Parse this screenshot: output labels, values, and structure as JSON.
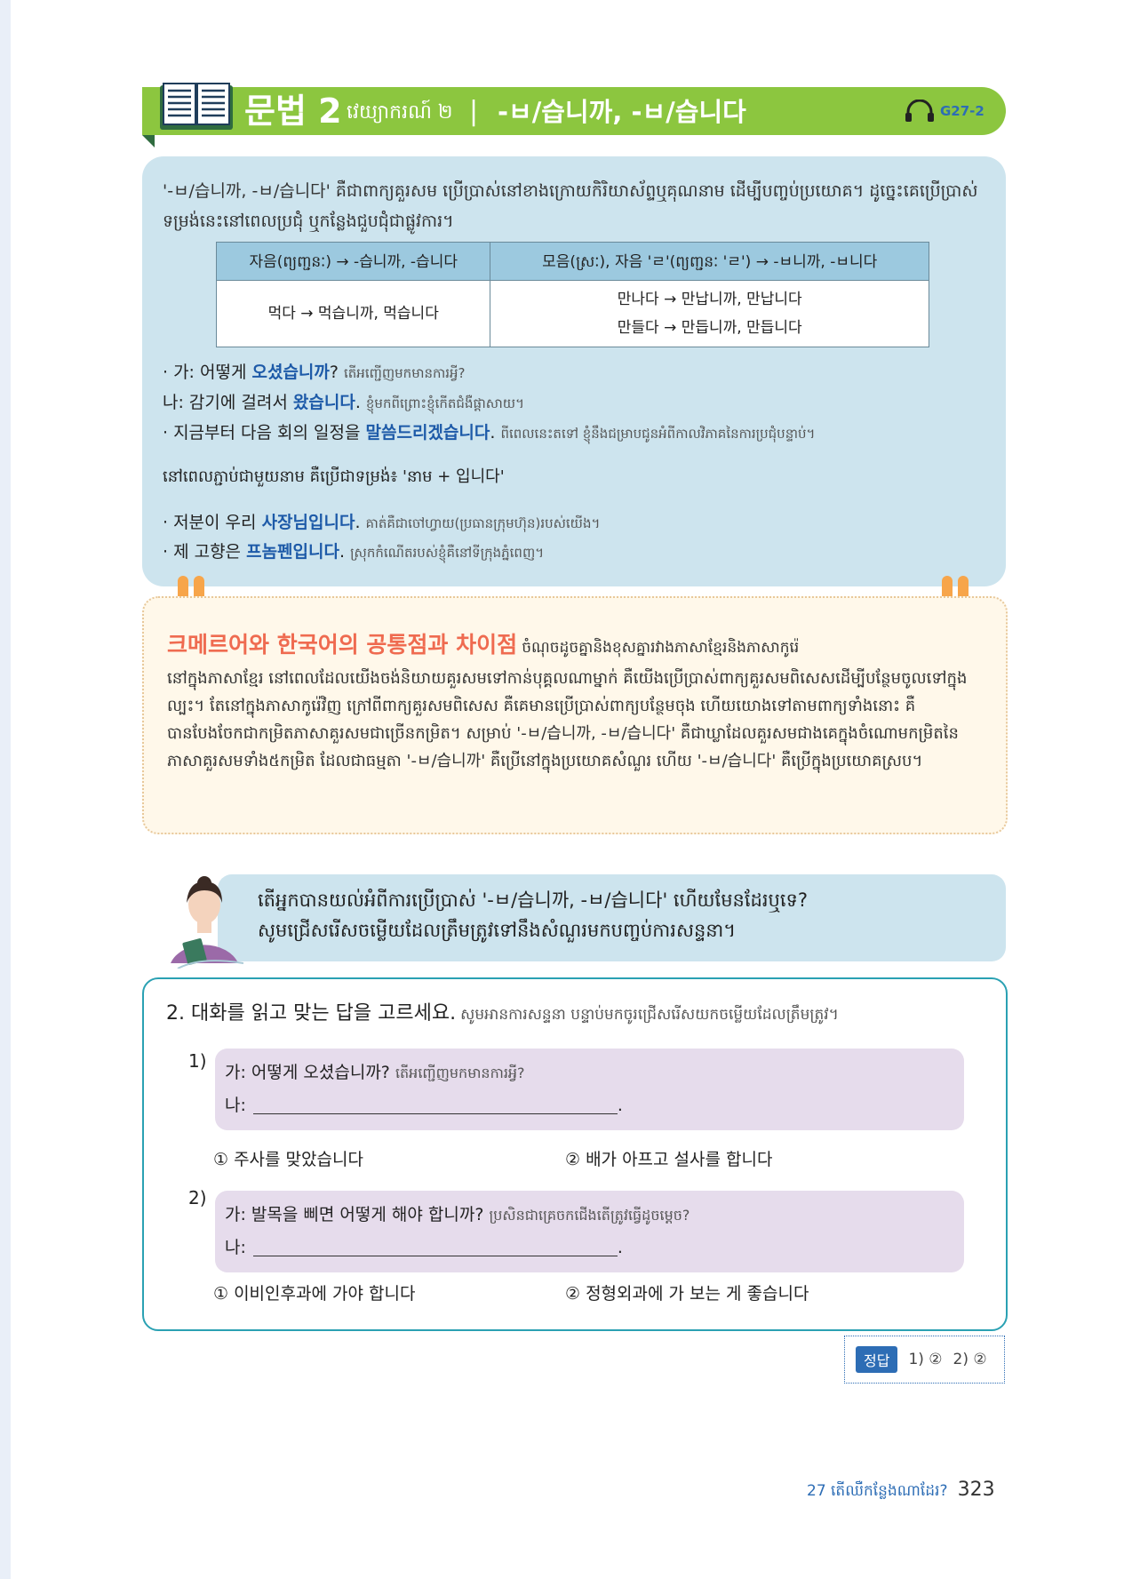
{
  "header": {
    "title": "문법 2",
    "khmer_subtitle": "វេយ្យាករណ៍ ២",
    "separator": "|",
    "form": "-ㅂ/습니까, -ㅂ/습니다",
    "audio_code": "G27-2"
  },
  "grammar": {
    "intro": "'-ㅂ/습니까, -ㅂ/습니다' គឺជាពាក្យគួរសម ប្រើប្រាស់នៅខាងក្រោយកិរិយាស័ព្ទឬគុណនាម ដើម្បីបញ្ចប់ប្រយោគ។ ដូច្នេះគេប្រើប្រាស់ទម្រង់នេះនៅពេលប្រជុំ ឬកន្លែងជួបជុំជាផ្លូវការ។",
    "table": {
      "headers": [
        "자음(ព្យញ្ជនៈ) → -습니까, -습니다",
        "모음(ស្រៈ), 자음 'ㄹ'(ព្យញ្ជនៈ 'ㄹ') → -ㅂ니까, -ㅂ니다"
      ],
      "cell1": "먹다 → 먹습니까, 먹습니다",
      "cell2_line1": "만나다 → 만납니까, 만납니다",
      "cell2_line2": "만들다 → 만듭니까, 만듭니다"
    },
    "examples": [
      {
        "pre": "· 가: 어떻게 ",
        "key": "오셨습니까",
        "post": "? ",
        "khmer": "តើអញ្ជើញមកមានការអ្វី?"
      },
      {
        "pre": "  나: 감기에 걸려서 ",
        "key": "왔습니다",
        "post": ". ",
        "khmer": "ខ្ញុំមកពីព្រោះខ្ញុំកើតជំងឺផ្ដាសាយ។"
      },
      {
        "pre": "· 지금부터 다음 회의 일정을 ",
        "key": "말씀드리겠습니다",
        "post": ". ",
        "khmer": "ពីពេលនេះតទៅ ខ្ញុំនឹងជម្រាបជូនអំពីកាលវិភាគនៃការប្រជុំបន្ទាប់។"
      }
    ],
    "noun_note": "នៅពេលភ្ជាប់ជាមួយនាម គឺប្រើជាទម្រង់៖ 'នាម + 입니다'",
    "noun_examples": [
      {
        "pre": "· 저분이 우리 ",
        "key": "사장님입니다",
        "post": ". ",
        "khmer": "គាត់គឺជាចៅហ្វាយ(ប្រធានក្រុមហ៊ុន)របស់យើង។"
      },
      {
        "pre": "· 제 고향은 ",
        "key": "프놈펜입니다",
        "post": ". ",
        "khmer": "ស្រុកកំណើតរបស់ខ្ញុំគឺនៅទីក្រុងភ្នំពេញ។"
      }
    ]
  },
  "compare": {
    "title_ko": "크메르어와 한국어의 공통점과 차이점",
    "title_km": "ចំណុចដូចគ្នានិងខុសគ្នារវាងភាសាខ្មែរនិងភាសាកូរ៉េ",
    "body": "នៅក្នុងភាសាខ្មែរ នៅពេលដែលយើងចង់និយាយគួរសមទៅកាន់បុគ្គលណាម្នាក់ គឺយើងប្រើប្រាស់ពាក្យគួរសមពិសេសដើម្បីបន្ថែមចូលទៅក្នុងល្បះ។ តែនៅក្នុងភាសាកូរ៉េវិញ ក្រៅពីពាក្យគួរសមពិសេស គឺគេមានប្រើប្រាស់ពាក្យបន្ថែមចុង ហើយយោងទៅតាមពាក្យទាំងនោះ គឺបានបែងចែកជាកម្រិតភាសាគួរសមជាច្រើនកម្រិត។ សម្រាប់ '-ㅂ/습니까, -ㅂ/습니다' គឺជាឃ្លាដែលគួរសមជាងគេក្នុងចំណោមកម្រិតនៃភាសាគួរសមទាំង៥កម្រិត ដែលជាធម្មតា '-ㅂ/습니까' គឺប្រើនៅក្នុងប្រយោគសំណួរ ហើយ '-ㅂ/습니다' គឺប្រើក្នុងប្រយោគស្រប។"
  },
  "prompt": {
    "line1": "តើអ្នកបានយល់អំពីការប្រើប្រាស់ '-ㅂ/습니까, -ㅂ/습니다' ហើយមែនដែរឬទេ?",
    "line2": "សូមជ្រើសរើសចម្លើយដែលត្រឹមត្រូវទៅនឹងសំណួរមកបញ្ចប់ការសន្ទនា។"
  },
  "exercise": {
    "heading_ko": "2. 대화를 읽고 맞는 답을 고르세요.",
    "heading_km": "សូមអានការសន្ទនា បន្ទាប់មកចូរជ្រើសរើសយកចម្លើយដែលត្រឹមត្រូវ។",
    "q1": {
      "num": "1)",
      "ga": "가: 어떻게 오셨습니까? ",
      "ga_km": "តើអញ្ជើញមកមានការអ្វី?",
      "na": "나:",
      "opt1": "① 주사를 맞았습니다",
      "opt2": "② 배가 아프고 설사를 합니다"
    },
    "q2": {
      "num": "2)",
      "ga": "가: 발목을 삐면 어떻게 해야 합니까? ",
      "ga_km": "ប្រសិនជាគ្រេចកជើងតើត្រូវធ្វើដូចម្ដេច?",
      "na": "나:",
      "opt1": "① 이비인후과에 가야 합니다",
      "opt2": "② 정형외과에 가 보는 게 좋습니다"
    },
    "period": "."
  },
  "answer": {
    "label": "정답",
    "a1": "1) ②",
    "a2": "2) ②"
  },
  "footer": {
    "chapter": "27 តើឈឺកន្លែងណាដែរ?",
    "page": "323"
  },
  "colors": {
    "header_green": "#8cc63f",
    "grammar_bg": "#cde4ee",
    "highlight_blue": "#1d5aa8",
    "compare_title": "#ef6b50",
    "exercise_border": "#2aa1b3",
    "question_bg": "#e6dcec"
  }
}
